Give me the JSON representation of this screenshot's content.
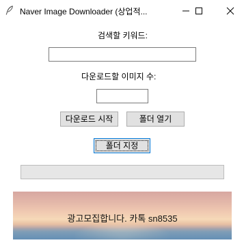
{
  "window": {
    "title": "Naver Image Downloader (상업적..."
  },
  "form": {
    "keyword_label": "검색할 키워드:",
    "keyword_value": "",
    "count_label": "다운로드할 이미지 수:",
    "count_value": ""
  },
  "buttons": {
    "start_download": "다운로드 시작",
    "open_folder": "폴더 열기",
    "set_folder": "폴더 지정"
  },
  "progress": {
    "value_percent": 0
  },
  "ad": {
    "text": "광고모집합니다. 카톡 sn8535"
  },
  "colors": {
    "button_face": "#e1e1e1",
    "focus_border": "#0078d7",
    "progress_track": "#e6e6e6"
  },
  "icons": [
    "feather-icon",
    "minimize-icon",
    "maximize-icon",
    "close-icon"
  ]
}
